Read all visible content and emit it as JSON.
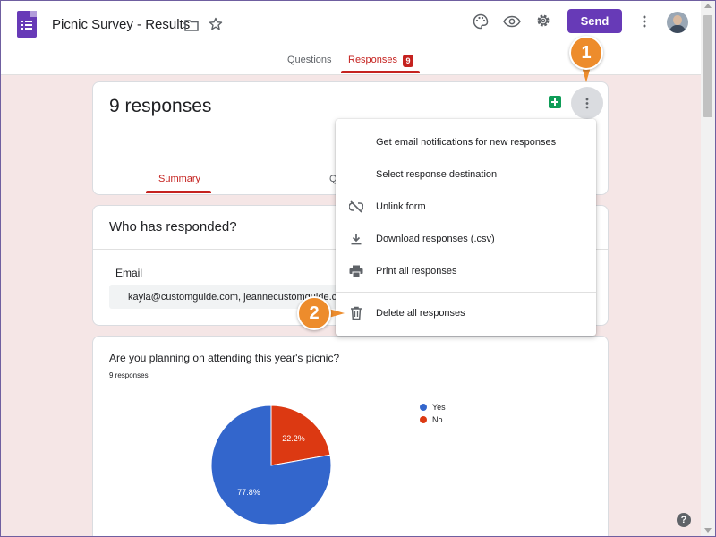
{
  "app": {
    "title": "Picnic Survey - Results",
    "send_label": "Send"
  },
  "tabs": [
    {
      "label": "Questions"
    },
    {
      "label": "Responses",
      "badge": "9"
    }
  ],
  "summary_card": {
    "count_title": "9 responses",
    "tabs": [
      {
        "label": "Summary"
      },
      {
        "label": "Q"
      }
    ]
  },
  "who_card": {
    "title": "Who has responded?",
    "email_label": "Email",
    "emails": "kayla@customguide.com, jeannecustomguide.co"
  },
  "question_card": {
    "question": "Are you planning on attending this year's picnic?",
    "count": "9 responses"
  },
  "menu": {
    "items": [
      {
        "label": "Get email notifications for new responses",
        "icon": ""
      },
      {
        "label": "Select response destination",
        "icon": ""
      },
      {
        "label": "Unlink form",
        "icon": "unlink-icon"
      },
      {
        "label": "Download responses (.csv)",
        "icon": "download-icon"
      },
      {
        "label": "Print all responses",
        "icon": "print-icon"
      },
      {
        "label": "Delete all responses",
        "icon": "trash-icon"
      }
    ]
  },
  "callouts": [
    "1",
    "2"
  ],
  "help": "?",
  "colors": {
    "brand": "#673ab7",
    "accent": "#c5221f",
    "callout": "#ed8c2c",
    "yes": "#3366cc",
    "no": "#dc3912"
  },
  "chart_data": {
    "type": "pie",
    "categories": [
      "Yes",
      "No"
    ],
    "values": [
      77.8,
      22.2
    ],
    "labels": [
      "77.8%",
      "22.2%"
    ],
    "colors": [
      "#3366cc",
      "#dc3912"
    ],
    "legend": "right"
  }
}
